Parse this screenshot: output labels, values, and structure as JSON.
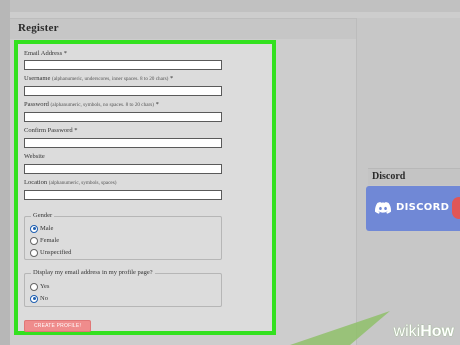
{
  "register": {
    "title": "Register"
  },
  "form": {
    "email": {
      "label": "Email Address",
      "required": "*",
      "value": ""
    },
    "username": {
      "label": "Username",
      "hint": "(alphanumeric, underscores, inner spaces. 8 to 20 chars)",
      "required": "*",
      "value": ""
    },
    "password": {
      "label": "Password",
      "hint": "(alphanumeric, symbols, no spaces. 8 to 20 chars)",
      "required": "*",
      "value": ""
    },
    "confirm_password": {
      "label": "Confirm Password",
      "required": "*",
      "value": ""
    },
    "website": {
      "label": "Website",
      "value": ""
    },
    "location": {
      "label": "Location",
      "hint": "(alphanumeric, symbols, spaces)",
      "value": ""
    },
    "gender": {
      "legend": "Gender",
      "options": [
        "Male",
        "Female",
        "Unspecified"
      ],
      "selected": "Male"
    },
    "display_email": {
      "legend": "Display my email address in my profile page?",
      "options": [
        "Yes",
        "No"
      ],
      "selected": "No"
    },
    "submit_label": "CREATE PROFILE!"
  },
  "sidebar": {
    "discord_title": "Discord",
    "discord_banner_text": "DISCORD"
  },
  "watermark": {
    "wiki": "wiki",
    "how": "How"
  },
  "colors": {
    "highlight_border": "#33e11f",
    "submit_button": "#ef8c8c",
    "discord_brand": "#7088d6",
    "radio_checked": "#1f5fb0"
  },
  "icons": {
    "discord": "discord-logo-icon",
    "radio": "radio-button-icon"
  }
}
